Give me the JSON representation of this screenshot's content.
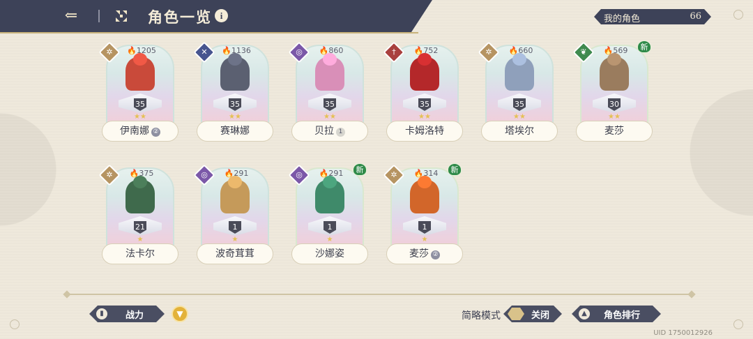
{
  "header": {
    "back_icon": "back-arrow-icon",
    "menu_icon": "grid-menu-icon",
    "title": "角色一览",
    "info_icon": "i",
    "owned_label": "我的角色",
    "owned_count": "66"
  },
  "characters": [
    {
      "name": "伊南娜",
      "power": "1205",
      "level": "35",
      "stars": "★★",
      "element": "light",
      "element_color": "#b69462",
      "badge": "②",
      "is_new": false,
      "sprite_color": "#c94a3a"
    },
    {
      "name": "赛琳娜",
      "power": "1136",
      "level": "35",
      "stars": "★★",
      "element": "slash",
      "element_color": "#47558f",
      "badge": "",
      "is_new": false,
      "sprite_color": "#5b6071"
    },
    {
      "name": "贝拉",
      "power": "860",
      "level": "35",
      "stars": "★★",
      "element": "arcane",
      "element_color": "#7b58a8",
      "badge": "1",
      "is_new": false,
      "sprite_color": "#d98fb8"
    },
    {
      "name": "卡姆洛特",
      "power": "752",
      "level": "35",
      "stars": "★★",
      "element": "blade",
      "element_color": "#a9403e",
      "badge": "",
      "is_new": false,
      "sprite_color": "#b4282a"
    },
    {
      "name": "塔埃尔",
      "power": "660",
      "level": "35",
      "stars": "★★",
      "element": "light",
      "element_color": "#b69462",
      "badge": "",
      "is_new": false,
      "sprite_color": "#8fa0bb"
    },
    {
      "name": "麦莎",
      "power": "569",
      "level": "30",
      "stars": "★★",
      "element": "nature",
      "element_color": "#3f8a4f",
      "badge": "",
      "is_new": true,
      "sprite_color": "#9a7c5e"
    },
    {
      "name": "法卡尔",
      "power": "375",
      "level": "21",
      "stars": "★",
      "element": "light",
      "element_color": "#b69462",
      "badge": "",
      "is_new": false,
      "sprite_color": "#3f6a4c"
    },
    {
      "name": "波奇茸茸",
      "power": "291",
      "level": "1",
      "stars": "★",
      "element": "arcane",
      "element_color": "#7b58a8",
      "badge": "",
      "is_new": false,
      "sprite_color": "#c59a5a"
    },
    {
      "name": "沙娜姿",
      "power": "291",
      "level": "1",
      "stars": "★",
      "element": "arcane",
      "element_color": "#7b58a8",
      "badge": "",
      "is_new": true,
      "sprite_color": "#3f8a6a"
    },
    {
      "name": "麦莎",
      "power": "314",
      "level": "1",
      "stars": "★",
      "element": "light",
      "element_color": "#b69462",
      "badge": "②",
      "is_new": true,
      "sprite_color": "#d2662a"
    }
  ],
  "new_tag": "新",
  "bottom": {
    "sort_label": "战力",
    "sort_icon": "bar-chart-icon",
    "filter_icon": "funnel-icon",
    "simple_mode_label": "简略模式",
    "simple_mode_value": "关闭",
    "ranking_label": "角色排行",
    "ranking_icon": "ranking-icon",
    "uid": "UID 1750012926"
  }
}
